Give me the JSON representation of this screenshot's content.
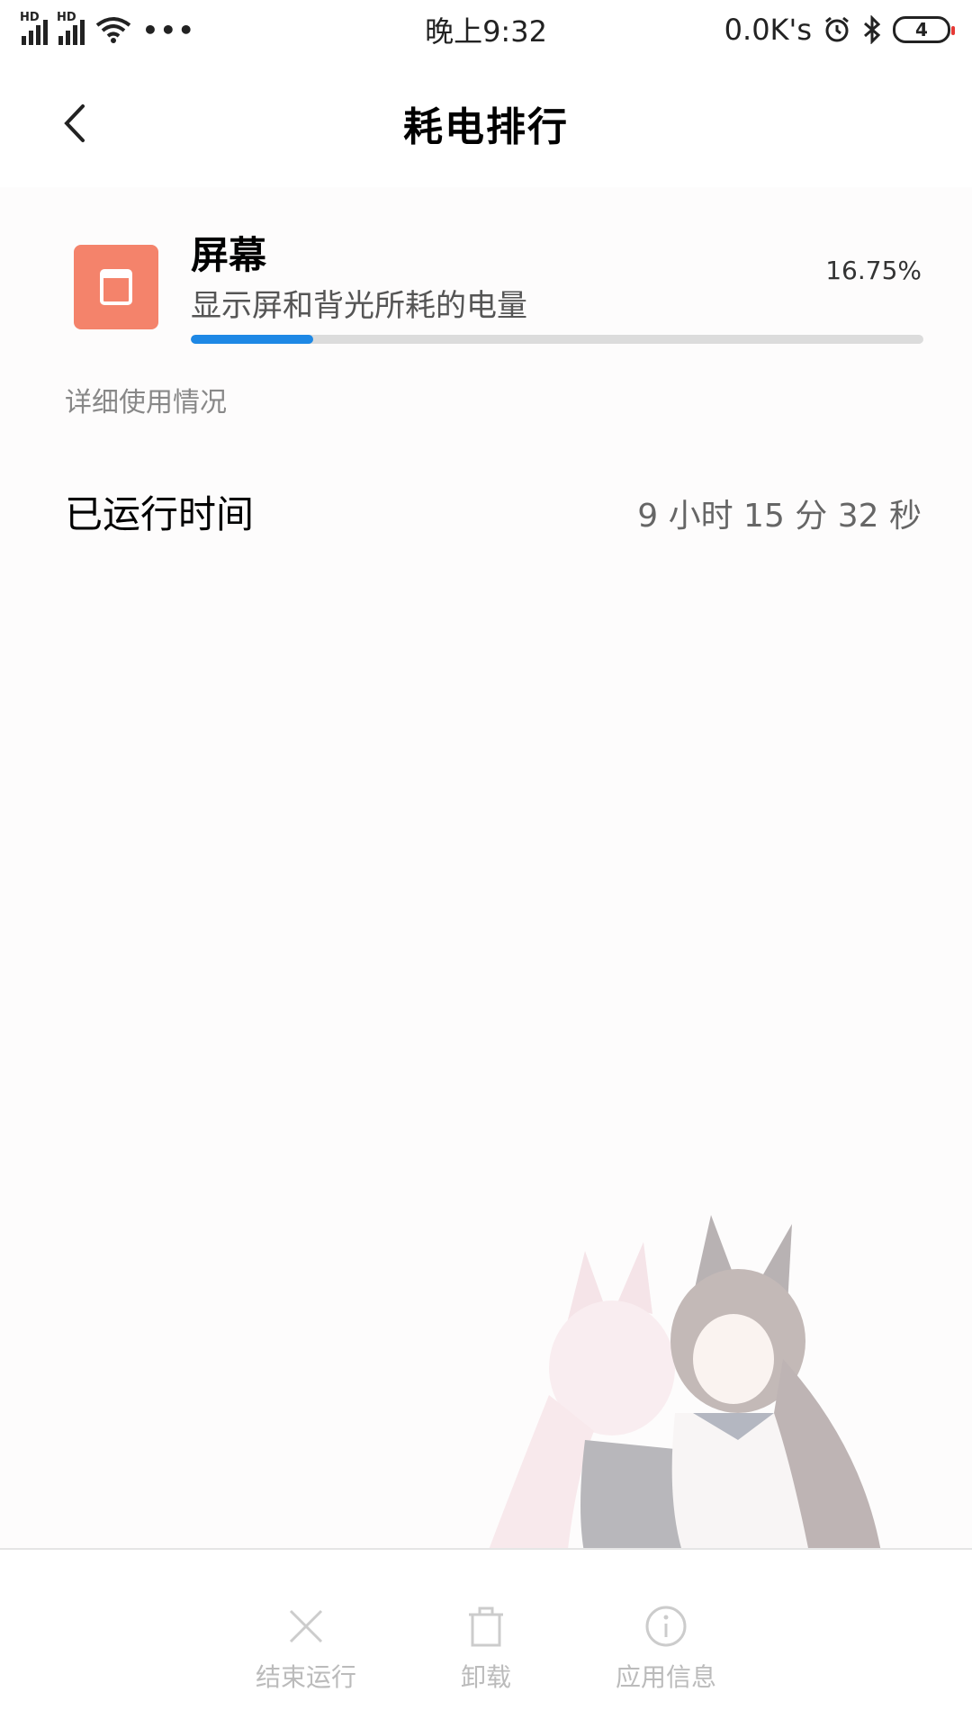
{
  "status_bar": {
    "signal1_label": "HD",
    "signal2_label": "HD",
    "more": "•••",
    "time": "晚上9:32",
    "network_speed": "0.0K's",
    "battery_level": "4"
  },
  "header": {
    "title": "耗电排行",
    "back_icon": "chevron-left-icon"
  },
  "item": {
    "icon": "screen-icon",
    "icon_color": "#f4836b",
    "title": "屏幕",
    "description": "显示屏和背光所耗的电量",
    "percent_label": "16.75%",
    "percent_value": 0.1675,
    "progress_color": "#1e88e5"
  },
  "details": {
    "section_label": "详细使用情况",
    "runtime_label": "已运行时间",
    "runtime_value": "9 小时 15 分 32 秒"
  },
  "actions": [
    {
      "label": "结束运行",
      "icon": "close-icon"
    },
    {
      "label": "卸载",
      "icon": "trash-icon"
    },
    {
      "label": "应用信息",
      "icon": "info-icon"
    }
  ]
}
